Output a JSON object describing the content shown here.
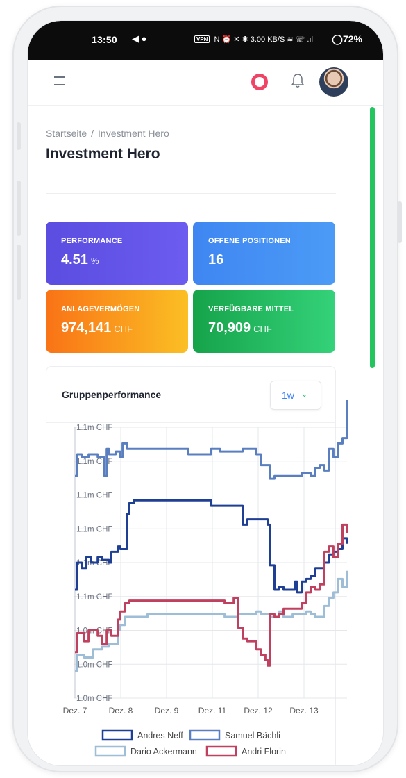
{
  "statusbar": {
    "time": "13:50",
    "loc_icons": "◀ ●",
    "vpn": "VPN",
    "mid_icons": "N ⏰ ✕ ✱ 3.00 KB/S ≋ ☏ .ıl",
    "battery": "72%"
  },
  "header": {
    "menu_icon": "hamburger-icon",
    "help_icon": "lifebuoy-icon",
    "notifications_icon": "bell-icon",
    "avatar": "user-avatar"
  },
  "breadcrumb": {
    "home": "Startseite",
    "separator": "/",
    "current": "Investment Hero"
  },
  "page_title": "Investment Hero",
  "cards": [
    {
      "label": "PERFORMANCE",
      "value": "4.51",
      "unit": "%"
    },
    {
      "label": "OFFENE POSITIONEN",
      "value": "16",
      "unit": ""
    },
    {
      "label": "ANLAGEVERMÖGEN",
      "value": "974,141",
      "unit": "CHF"
    },
    {
      "label": "VERFÜGBARE MITTEL",
      "value": "70,909",
      "unit": "CHF"
    }
  ],
  "chart_section": {
    "title": "Gruppenperformance",
    "range": "1w"
  },
  "colors": {
    "andres": "#1e3f93",
    "samuel": "#5a7fc0",
    "dario": "#9dbed6",
    "andri": "#c0405f",
    "accent_green": "#22c55e"
  },
  "chart_data": {
    "type": "line",
    "y_tick_labels": [
      "1.1m CHF",
      "1.1m CHF",
      "1.1m CHF",
      "1.1m CHF",
      "1.1m CHF",
      "1.1m CHF",
      "1.0m CHF",
      "1.0m CHF",
      "1.0m CHF"
    ],
    "x_tick_labels": [
      "Dez. 7",
      "Dez. 8",
      "Dez. 9",
      "Dez. 11",
      "Dez. 12",
      "Dez. 13"
    ],
    "ylim": [
      1.0,
      1.1
    ],
    "grid": true,
    "legend": "bottom",
    "series": [
      {
        "name": "Andres Neff",
        "x": [
          0,
          0.05,
          0.15,
          0.25,
          0.35,
          0.5,
          0.6,
          0.75,
          0.8,
          0.95,
          1.0,
          1.15,
          1.2,
          1.3,
          1.5,
          2.0,
          2.5,
          2.9,
          3.0,
          3.2,
          3.4,
          3.6,
          3.7,
          3.8,
          3.9,
          4.0,
          4.1,
          4.2,
          4.25,
          4.3,
          4.4,
          4.5,
          4.6,
          4.7,
          4.8,
          4.85,
          4.9,
          5.0,
          5.1,
          5.2,
          5.3,
          5.4,
          5.5,
          5.6,
          5.7,
          5.8,
          5.9,
          6.0
        ],
        "values": [
          1.04,
          1.05,
          1.048,
          1.052,
          1.05,
          1.052,
          1.051,
          1.05,
          1.054,
          1.056,
          1.055,
          1.068,
          1.072,
          1.073,
          1.073,
          1.073,
          1.073,
          1.073,
          1.071,
          1.071,
          1.071,
          1.071,
          1.064,
          1.066,
          1.066,
          1.066,
          1.066,
          1.066,
          1.064,
          1.049,
          1.04,
          1.041,
          1.04,
          1.04,
          1.04,
          1.043,
          1.039,
          1.043,
          1.044,
          1.045,
          1.048,
          1.048,
          1.05,
          1.053,
          1.054,
          1.055,
          1.059,
          1.057
        ]
      },
      {
        "name": "Samuel Bächli",
        "x": [
          0,
          0.05,
          0.15,
          0.3,
          0.5,
          0.65,
          0.7,
          0.75,
          0.9,
          1.0,
          1.05,
          1.15,
          1.3,
          1.5,
          2.0,
          2.5,
          3.0,
          3.2,
          3.4,
          3.7,
          4.0,
          4.1,
          4.3,
          4.4,
          4.6,
          4.8,
          5.0,
          5.2,
          5.3,
          5.4,
          5.5,
          5.6,
          5.7,
          5.8,
          5.9,
          6.0
        ],
        "values": [
          1.082,
          1.09,
          1.089,
          1.09,
          1.089,
          1.082,
          1.092,
          1.09,
          1.091,
          1.089,
          1.094,
          1.092,
          1.092,
          1.092,
          1.092,
          1.09,
          1.092,
          1.091,
          1.091,
          1.092,
          1.09,
          1.086,
          1.081,
          1.082,
          1.082,
          1.082,
          1.083,
          1.082,
          1.085,
          1.086,
          1.084,
          1.092,
          1.089,
          1.094,
          1.096,
          1.11
        ]
      },
      {
        "name": "Dario Ackermann",
        "x": [
          0,
          0.05,
          0.2,
          0.4,
          0.6,
          0.75,
          0.95,
          1.0,
          1.1,
          1.2,
          1.4,
          1.6,
          2.0,
          2.5,
          3.0,
          3.3,
          3.6,
          3.8,
          4.0,
          4.1,
          4.3,
          4.5,
          4.6,
          4.8,
          5.0,
          5.1,
          5.2,
          5.3,
          5.4,
          5.5,
          5.6,
          5.7,
          5.8,
          5.9,
          6.0
        ],
        "values": [
          1.01,
          1.016,
          1.015,
          1.018,
          1.019,
          1.02,
          1.025,
          1.027,
          1.03,
          1.03,
          1.03,
          1.031,
          1.031,
          1.031,
          1.031,
          1.03,
          1.031,
          1.031,
          1.032,
          1.031,
          1.03,
          1.032,
          1.03,
          1.031,
          1.031,
          1.032,
          1.031,
          1.03,
          1.03,
          1.034,
          1.037,
          1.039,
          1.044,
          1.041,
          1.047
        ]
      },
      {
        "name": "Andri Florin",
        "x": [
          0,
          0.05,
          0.2,
          0.3,
          0.5,
          0.6,
          0.7,
          0.8,
          0.95,
          1.0,
          1.1,
          1.2,
          1.4,
          1.6,
          2.0,
          2.5,
          3.0,
          3.3,
          3.5,
          3.6,
          3.7,
          3.8,
          4.0,
          4.1,
          4.2,
          4.25,
          4.3,
          4.4,
          4.5,
          4.6,
          4.8,
          5.0,
          5.1,
          5.2,
          5.3,
          5.4,
          5.5,
          5.6,
          5.7,
          5.8,
          5.9,
          6.0
        ],
        "values": [
          1.017,
          1.024,
          1.021,
          1.025,
          1.023,
          1.02,
          1.025,
          1.023,
          1.029,
          1.032,
          1.035,
          1.036,
          1.036,
          1.036,
          1.036,
          1.036,
          1.036,
          1.035,
          1.037,
          1.026,
          1.022,
          1.021,
          1.018,
          1.016,
          1.014,
          1.012,
          1.031,
          1.03,
          1.031,
          1.033,
          1.033,
          1.035,
          1.039,
          1.041,
          1.04,
          1.042,
          1.054,
          1.056,
          1.052,
          1.057,
          1.064,
          1.061
        ]
      }
    ]
  }
}
